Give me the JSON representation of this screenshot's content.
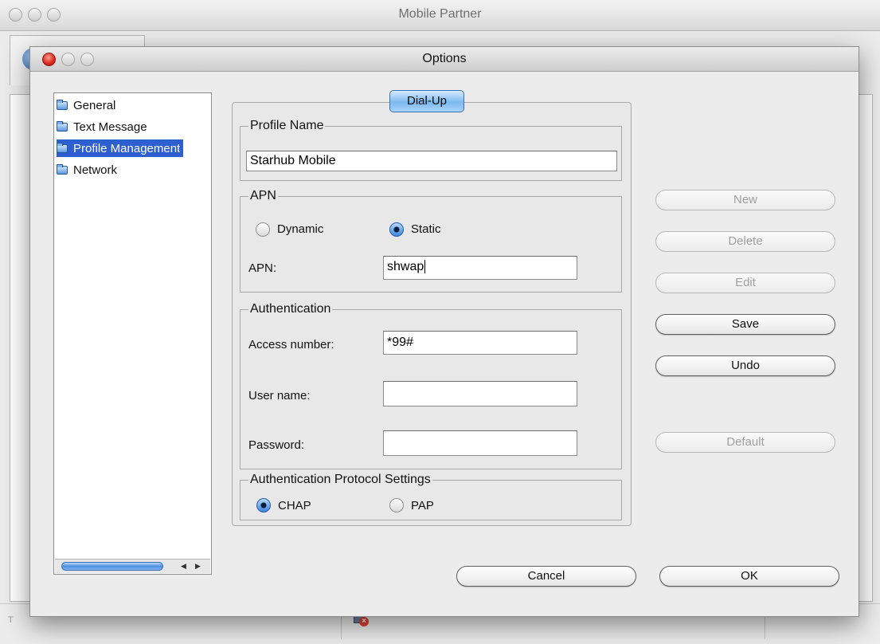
{
  "main_window": {
    "title": "Mobile Partner",
    "status_letter": "T"
  },
  "dialog": {
    "title": "Options",
    "tree": {
      "items": [
        {
          "label": "General"
        },
        {
          "label": "Text Message"
        },
        {
          "label": "Profile Management",
          "selected": true
        },
        {
          "label": "Network"
        }
      ]
    },
    "tab": {
      "label": "Dial-Up"
    },
    "profile_name": {
      "legend": "Profile Name",
      "value": "Starhub Mobile"
    },
    "apn": {
      "legend": "APN",
      "dynamic_label": "Dynamic",
      "static_label": "Static",
      "selected": "Static",
      "apn_label": "APN:",
      "apn_value": "shwap"
    },
    "authentication": {
      "legend": "Authentication",
      "access_number_label": "Access number:",
      "access_number_value": "*99#",
      "user_name_label": "User name:",
      "user_name_value": "",
      "password_label": "Password:",
      "password_value": ""
    },
    "auth_protocol": {
      "legend": "Authentication Protocol Settings",
      "chap_label": "CHAP",
      "pap_label": "PAP",
      "selected": "CHAP"
    },
    "side_buttons": {
      "new": "New",
      "delete": "Delete",
      "edit": "Edit",
      "save": "Save",
      "undo": "Undo",
      "default": "Default"
    },
    "footer": {
      "cancel": "Cancel",
      "ok": "OK"
    }
  },
  "colors": {
    "selection": "#2e5fd0",
    "close_button": "#d8261d",
    "tab_accent": "#7cb9f0"
  }
}
